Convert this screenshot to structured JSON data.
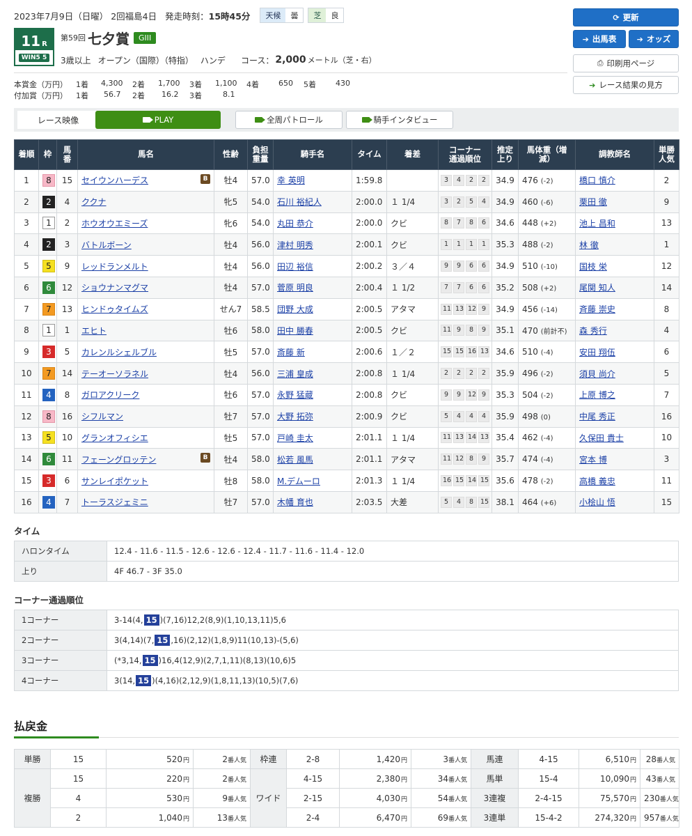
{
  "header": {
    "date": "2023年7月9日（日曜）",
    "meeting": "2回福島4日",
    "start_label": "発走時刻：",
    "start_time": "15時45分",
    "weather_label": "天候",
    "weather": "曇",
    "track_label": "芝",
    "track_cond": "良"
  },
  "race": {
    "number": "11",
    "number_suffix": "R",
    "win5_label": "WIN5",
    "win5_num": "5",
    "kai": "第59回",
    "name": "七夕賞",
    "grade": "GIII",
    "age": "3歳以上",
    "class": "オープン（国際）（特指）",
    "weight_rule": "ハンデ",
    "course_label": "コース：",
    "distance": "2,000",
    "distance_unit": "メートル（芝・右）"
  },
  "prize": {
    "main_label": "本賞金（万円）",
    "add_label": "付加賞（万円）",
    "main": [
      {
        "rank": "1着",
        "val": "4,300"
      },
      {
        "rank": "2着",
        "val": "1,700"
      },
      {
        "rank": "3着",
        "val": "1,100"
      },
      {
        "rank": "4着",
        "val": "650"
      },
      {
        "rank": "5着",
        "val": "430"
      }
    ],
    "add": [
      {
        "rank": "1着",
        "val": "56.7"
      },
      {
        "rank": "2着",
        "val": "16.2"
      },
      {
        "rank": "3着",
        "val": "8.1"
      }
    ]
  },
  "buttons": {
    "refresh": "更新",
    "entries": "出馬表",
    "odds": "オッズ",
    "print": "印刷用ページ",
    "howto": "レース結果の見方"
  },
  "video": {
    "label": "レース映像",
    "play": "PLAY",
    "patrol": "全周パトロール",
    "interview": "騎手インタビュー"
  },
  "table": {
    "headers": [
      "着順",
      "枠",
      "馬番",
      "馬名",
      "性齢",
      "負担重量",
      "騎手名",
      "タイム",
      "着差",
      "コーナー通過順位",
      "推定上り",
      "馬体重（増減）",
      "調教師名",
      "単勝人気"
    ],
    "rows": [
      {
        "rank": "1",
        "waku": "8",
        "num": "15",
        "name": "セイウンハーデス",
        "blinker": "B",
        "sex": "牡4",
        "wt": "57.0",
        "jockey": "幸 英明",
        "time": "1:59.8",
        "margin": "",
        "corner": [
          "3",
          "4",
          "2",
          "2"
        ],
        "last": "34.9",
        "bw": "476",
        "bwd": "(-2)",
        "trainer": "橋口 慎介",
        "pop": "2"
      },
      {
        "rank": "2",
        "waku": "2",
        "num": "4",
        "name": "ククナ",
        "blinker": "",
        "sex": "牝5",
        "wt": "54.0",
        "jockey": "石川 裕紀人",
        "time": "2:00.0",
        "margin": "１ 1/4",
        "corner": [
          "3",
          "2",
          "5",
          "4"
        ],
        "last": "34.9",
        "bw": "460",
        "bwd": "(-6)",
        "trainer": "栗田 徹",
        "pop": "9"
      },
      {
        "rank": "3",
        "waku": "1",
        "num": "2",
        "name": "ホウオウエミーズ",
        "blinker": "",
        "sex": "牝6",
        "wt": "54.0",
        "jockey": "丸田 恭介",
        "time": "2:00.0",
        "margin": "クビ",
        "corner": [
          "8",
          "7",
          "8",
          "6"
        ],
        "last": "34.6",
        "bw": "448",
        "bwd": "(+2)",
        "trainer": "池上 昌和",
        "pop": "13"
      },
      {
        "rank": "4",
        "waku": "2",
        "num": "3",
        "name": "バトルボーン",
        "blinker": "",
        "sex": "牡4",
        "wt": "56.0",
        "jockey": "津村 明秀",
        "time": "2:00.1",
        "margin": "クビ",
        "corner": [
          "1",
          "1",
          "1",
          "1"
        ],
        "last": "35.3",
        "bw": "488",
        "bwd": "(-2)",
        "trainer": "林 徹",
        "pop": "1"
      },
      {
        "rank": "5",
        "waku": "5",
        "num": "9",
        "name": "レッドランメルト",
        "blinker": "",
        "sex": "牡4",
        "wt": "56.0",
        "jockey": "田辺 裕信",
        "time": "2:00.2",
        "margin": "３／４",
        "corner": [
          "9",
          "9",
          "6",
          "6"
        ],
        "last": "34.9",
        "bw": "510",
        "bwd": "(-10)",
        "trainer": "国枝 栄",
        "pop": "12"
      },
      {
        "rank": "6",
        "waku": "6",
        "num": "12",
        "name": "ショウナンマグマ",
        "blinker": "",
        "sex": "牡4",
        "wt": "57.0",
        "jockey": "菅原 明良",
        "time": "2:00.4",
        "margin": "１ 1/2",
        "corner": [
          "7",
          "7",
          "6",
          "6"
        ],
        "last": "35.2",
        "bw": "508",
        "bwd": "(+2)",
        "trainer": "尾関 知人",
        "pop": "14"
      },
      {
        "rank": "7",
        "waku": "7",
        "num": "13",
        "name": "ヒンドゥタイムズ",
        "blinker": "",
        "sex": "せん7",
        "wt": "58.5",
        "jockey": "団野 大成",
        "time": "2:00.5",
        "margin": "アタマ",
        "corner": [
          "11",
          "13",
          "12",
          "9"
        ],
        "last": "34.9",
        "bw": "456",
        "bwd": "(-14)",
        "trainer": "斉藤 崇史",
        "pop": "8"
      },
      {
        "rank": "8",
        "waku": "1",
        "num": "1",
        "name": "エヒト",
        "blinker": "",
        "sex": "牡6",
        "wt": "58.0",
        "jockey": "田中 勝春",
        "time": "2:00.5",
        "margin": "クビ",
        "corner": [
          "11",
          "9",
          "8",
          "9"
        ],
        "last": "35.1",
        "bw": "470",
        "bwd": "(前計不)",
        "trainer": "森 秀行",
        "pop": "4"
      },
      {
        "rank": "9",
        "waku": "3",
        "num": "5",
        "name": "カレンルシェルブル",
        "blinker": "",
        "sex": "牡5",
        "wt": "57.0",
        "jockey": "斎藤 新",
        "time": "2:00.6",
        "margin": "１／２",
        "corner": [
          "15",
          "15",
          "16",
          "13"
        ],
        "last": "34.6",
        "bw": "510",
        "bwd": "(-4)",
        "trainer": "安田 翔伍",
        "pop": "6"
      },
      {
        "rank": "10",
        "waku": "7",
        "num": "14",
        "name": "テーオーソラネル",
        "blinker": "",
        "sex": "牡4",
        "wt": "56.0",
        "jockey": "三浦 皇成",
        "time": "2:00.8",
        "margin": "１ 1/4",
        "corner": [
          "2",
          "2",
          "2",
          "2"
        ],
        "last": "35.9",
        "bw": "496",
        "bwd": "(-2)",
        "trainer": "須貝 尚介",
        "pop": "5"
      },
      {
        "rank": "11",
        "waku": "4",
        "num": "8",
        "name": "ガロアクリーク",
        "blinker": "",
        "sex": "牡6",
        "wt": "57.0",
        "jockey": "永野 猛蔵",
        "time": "2:00.8",
        "margin": "クビ",
        "corner": [
          "9",
          "9",
          "12",
          "9"
        ],
        "last": "35.3",
        "bw": "504",
        "bwd": "(-2)",
        "trainer": "上原 博之",
        "pop": "7"
      },
      {
        "rank": "12",
        "waku": "8",
        "num": "16",
        "name": "シフルマン",
        "blinker": "",
        "sex": "牡7",
        "wt": "57.0",
        "jockey": "大野 拓弥",
        "time": "2:00.9",
        "margin": "クビ",
        "corner": [
          "5",
          "4",
          "4",
          "4"
        ],
        "last": "35.9",
        "bw": "498",
        "bwd": "(0)",
        "trainer": "中尾 秀正",
        "pop": "16"
      },
      {
        "rank": "13",
        "waku": "5",
        "num": "10",
        "name": "グランオフィシエ",
        "blinker": "",
        "sex": "牡5",
        "wt": "57.0",
        "jockey": "戸崎 圭太",
        "time": "2:01.1",
        "margin": "１ 1/4",
        "corner": [
          "11",
          "13",
          "14",
          "13"
        ],
        "last": "35.4",
        "bw": "462",
        "bwd": "(-4)",
        "trainer": "久保田 貴士",
        "pop": "10"
      },
      {
        "rank": "14",
        "waku": "6",
        "num": "11",
        "name": "フェーングロッテン",
        "blinker": "B",
        "sex": "牡4",
        "wt": "58.0",
        "jockey": "松若 風馬",
        "time": "2:01.1",
        "margin": "アタマ",
        "corner": [
          "11",
          "12",
          "8",
          "9"
        ],
        "last": "35.7",
        "bw": "474",
        "bwd": "(-4)",
        "trainer": "宮本 博",
        "pop": "3"
      },
      {
        "rank": "15",
        "waku": "3",
        "num": "6",
        "name": "サンレイポケット",
        "blinker": "",
        "sex": "牡8",
        "wt": "58.0",
        "jockey": "M.デムーロ",
        "time": "2:01.3",
        "margin": "１ 1/4",
        "corner": [
          "16",
          "15",
          "14",
          "15"
        ],
        "last": "35.6",
        "bw": "478",
        "bwd": "(-2)",
        "trainer": "高橋 義忠",
        "pop": "11"
      },
      {
        "rank": "16",
        "waku": "4",
        "num": "7",
        "name": "トーラスジェミニ",
        "blinker": "",
        "sex": "牡7",
        "wt": "57.0",
        "jockey": "木幡 育也",
        "time": "2:03.5",
        "margin": "大差",
        "corner": [
          "5",
          "4",
          "8",
          "15"
        ],
        "last": "38.1",
        "bw": "464",
        "bwd": "(+6)",
        "trainer": "小桧山 悟",
        "pop": "15"
      }
    ]
  },
  "time_section": {
    "title": "タイム",
    "halon_label": "ハロンタイム",
    "halon": "12.4 - 11.6 - 11.5 - 12.6 - 12.6 - 12.4 - 11.7 - 11.6 - 11.4 - 12.0",
    "agari_label": "上り",
    "agari": "4F 46.7 - 3F 35.0"
  },
  "corner_section": {
    "title": "コーナー通過順位",
    "rows": [
      {
        "label": "1コーナー",
        "pre": "3-14(4,",
        "win": "15",
        "post": ")(7,16)12,2(8,9)(1,10,13,11)5,6"
      },
      {
        "label": "2コーナー",
        "pre": "3(4,14)(7,",
        "win": "15",
        "post": ",16)(2,12)(1,8,9)11(10,13)-(5,6)"
      },
      {
        "label": "3コーナー",
        "pre": "(*3,14,",
        "win": "15",
        "post": ")16,4(12,9)(2,7,1,11)(8,13)(10,6)5"
      },
      {
        "label": "4コーナー",
        "pre": "3(14,",
        "win": "15",
        "post": ")(4,16)(2,12,9)(1,8,11,13)(10,5)(7,6)"
      }
    ]
  },
  "payout": {
    "title": "払戻金",
    "yen": "円",
    "pop_suffix": "番人気",
    "tansho": {
      "label": "単勝",
      "num": "15",
      "yen": "520",
      "pop": "2"
    },
    "fukusho": {
      "label": "複勝",
      "rows": [
        {
          "num": "15",
          "yen": "220",
          "pop": "2"
        },
        {
          "num": "4",
          "yen": "530",
          "pop": "9"
        },
        {
          "num": "2",
          "yen": "1,040",
          "pop": "13"
        }
      ]
    },
    "wakuren": {
      "label": "枠連",
      "num": "2-8",
      "yen": "1,420",
      "pop": "3"
    },
    "wide": {
      "label": "ワイド",
      "rows": [
        {
          "num": "4-15",
          "yen": "2,380",
          "pop": "34"
        },
        {
          "num": "2-15",
          "yen": "4,030",
          "pop": "54"
        },
        {
          "num": "2-4",
          "yen": "6,470",
          "pop": "69"
        }
      ]
    },
    "umaren": {
      "label": "馬連",
      "num": "4-15",
      "yen": "6,510",
      "pop": "28"
    },
    "umatan": {
      "label": "馬単",
      "num": "15-4",
      "yen": "10,090",
      "pop": "43"
    },
    "sanrenpuku": {
      "label": "3連複",
      "num": "2-4-15",
      "yen": "75,570",
      "pop": "230"
    },
    "sanrentan": {
      "label": "3連単",
      "num": "15-4-2",
      "yen": "274,320",
      "pop": "957"
    }
  }
}
